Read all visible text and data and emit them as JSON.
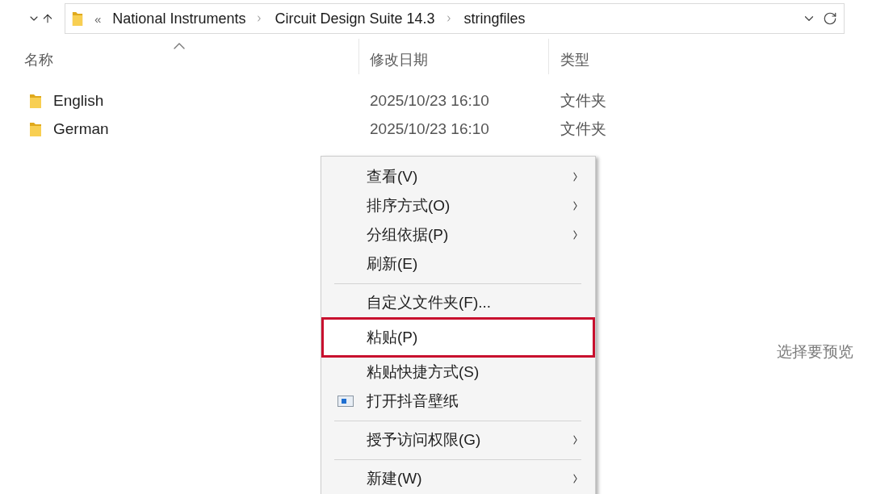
{
  "address_bar": {
    "overflow": "«",
    "crumbs": [
      "National Instruments",
      "Circuit Design Suite 14.3",
      "stringfiles"
    ]
  },
  "columns": [
    {
      "label": "名称",
      "sorted": true
    },
    {
      "label": "修改日期",
      "sorted": false
    },
    {
      "label": "类型",
      "sorted": false
    }
  ],
  "rows": [
    {
      "name": "English",
      "modified": "2025/10/23 16:10",
      "type": "文件夹"
    },
    {
      "name": "German",
      "modified": "2025/10/23 16:10",
      "type": "文件夹"
    }
  ],
  "context_menu": {
    "items": [
      {
        "kind": "item",
        "label": "查看(V)",
        "submenu": true,
        "highlighted": false
      },
      {
        "kind": "item",
        "label": "排序方式(O)",
        "submenu": true,
        "highlighted": false
      },
      {
        "kind": "item",
        "label": "分组依据(P)",
        "submenu": true,
        "highlighted": false
      },
      {
        "kind": "item",
        "label": "刷新(E)",
        "submenu": false,
        "highlighted": false
      },
      {
        "kind": "separator"
      },
      {
        "kind": "item",
        "label": "自定义文件夹(F)...",
        "submenu": false,
        "highlighted": false
      },
      {
        "kind": "item",
        "label": "粘贴(P)",
        "submenu": false,
        "highlighted": true
      },
      {
        "kind": "item",
        "label": "粘贴快捷方式(S)",
        "submenu": false,
        "highlighted": false
      },
      {
        "kind": "icon_item",
        "label": "打开抖音壁纸",
        "submenu": false,
        "highlighted": false
      },
      {
        "kind": "separator"
      },
      {
        "kind": "item",
        "label": "授予访问权限(G)",
        "submenu": true,
        "highlighted": false
      },
      {
        "kind": "separator"
      },
      {
        "kind": "item",
        "label": "新建(W)",
        "submenu": true,
        "highlighted": false
      }
    ]
  },
  "preview_pane": {
    "message": "选择要预览"
  }
}
